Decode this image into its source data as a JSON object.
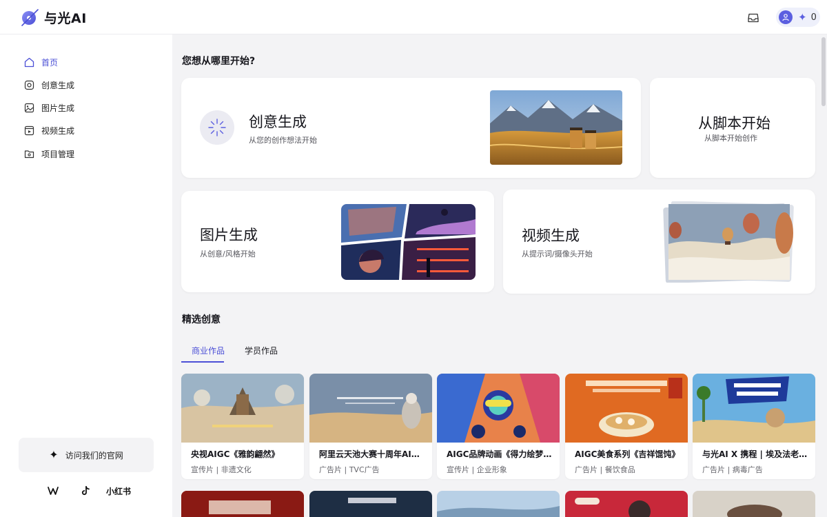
{
  "app": {
    "name": "与光AI"
  },
  "header": {
    "credits": "0"
  },
  "sidebar": {
    "items": [
      {
        "label": "首页",
        "icon": "home-icon"
      },
      {
        "label": "创意生成",
        "icon": "creative-icon"
      },
      {
        "label": "图片生成",
        "icon": "image-icon"
      },
      {
        "label": "视频生成",
        "icon": "video-icon"
      },
      {
        "label": "项目管理",
        "icon": "folder-icon"
      }
    ],
    "visit_label": "访问我们的官网",
    "socials": [
      "weibo-icon",
      "douyin-icon",
      "小红书"
    ]
  },
  "main": {
    "start_title": "您想从哪里开始?",
    "cards": {
      "creative": {
        "title": "创意生成",
        "subtitle": "从您的创作想法开始"
      },
      "script": {
        "title": "从脚本开始",
        "subtitle": "从脚本开始创作"
      },
      "image": {
        "title": "图片生成",
        "subtitle": "从创意/风格开始"
      },
      "video": {
        "title": "视频生成",
        "subtitle": "从提示词/摄像头开始"
      }
    },
    "featured_title": "精选创意",
    "tabs": [
      {
        "label": "商业作品",
        "active": true
      },
      {
        "label": "学员作品",
        "active": false
      }
    ],
    "gallery": [
      {
        "title": "央视AIGC《雅韵翩然》",
        "meta": "宣传片 | 非遗文化"
      },
      {
        "title": "阿里云天池大赛十周年AIGC创意片",
        "meta": "广告片 | TVC广告"
      },
      {
        "title": "AIGC品牌动画《得力绘梦之旅》",
        "meta": "宣传片 | 企业形象"
      },
      {
        "title": "AIGC美食系列《吉祥馄饨》",
        "meta": "广告片 | 餐饮食品"
      },
      {
        "title": "与光AI X 携程 | 埃及法老的旅行",
        "meta": "广告片 | 病毒广告"
      }
    ]
  },
  "colors": {
    "accent": "#4b4fd6",
    "background": "#f3f3f5",
    "card": "#ffffff"
  }
}
